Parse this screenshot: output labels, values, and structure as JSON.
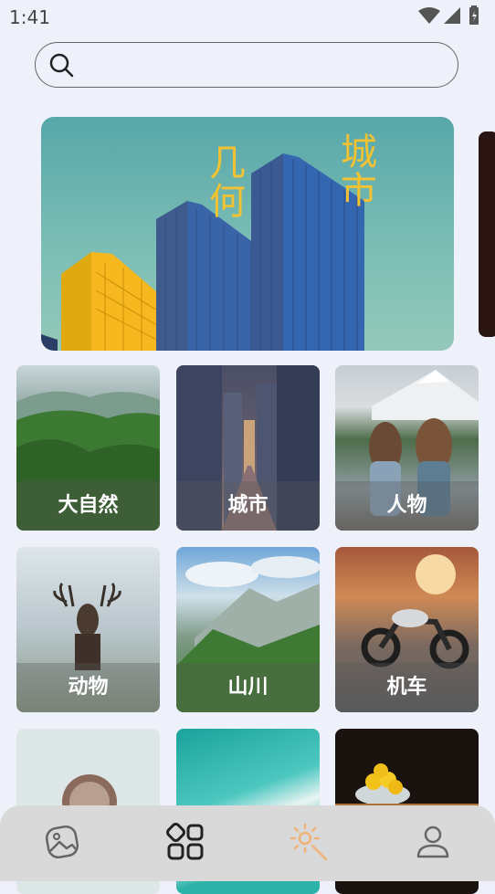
{
  "status_bar": {
    "time": "1:41"
  },
  "search": {
    "placeholder": "",
    "value": ""
  },
  "banner": {
    "title_left": "几何",
    "title_right": "城市"
  },
  "categories": [
    {
      "label": "大自然",
      "theme": "nature"
    },
    {
      "label": "城市",
      "theme": "city"
    },
    {
      "label": "人物",
      "theme": "people"
    },
    {
      "label": "动物",
      "theme": "animal"
    },
    {
      "label": "山川",
      "theme": "mountain"
    },
    {
      "label": "机车",
      "theme": "motorcycle"
    },
    {
      "label": "",
      "theme": "coffee"
    },
    {
      "label": "",
      "theme": "ocean"
    },
    {
      "label": "",
      "theme": "lemon"
    }
  ],
  "bottom_nav": {
    "items": [
      {
        "icon": "gallery-icon",
        "active": false
      },
      {
        "icon": "categories-grid-icon",
        "active": true
      },
      {
        "icon": "magic-wand-icon",
        "active": false
      },
      {
        "icon": "profile-icon",
        "active": false
      }
    ]
  },
  "colors": {
    "background": "#eef1fa",
    "accent": "#f2c232",
    "nav_bg": "#d9d9d9",
    "wand": "#f0b27a"
  }
}
